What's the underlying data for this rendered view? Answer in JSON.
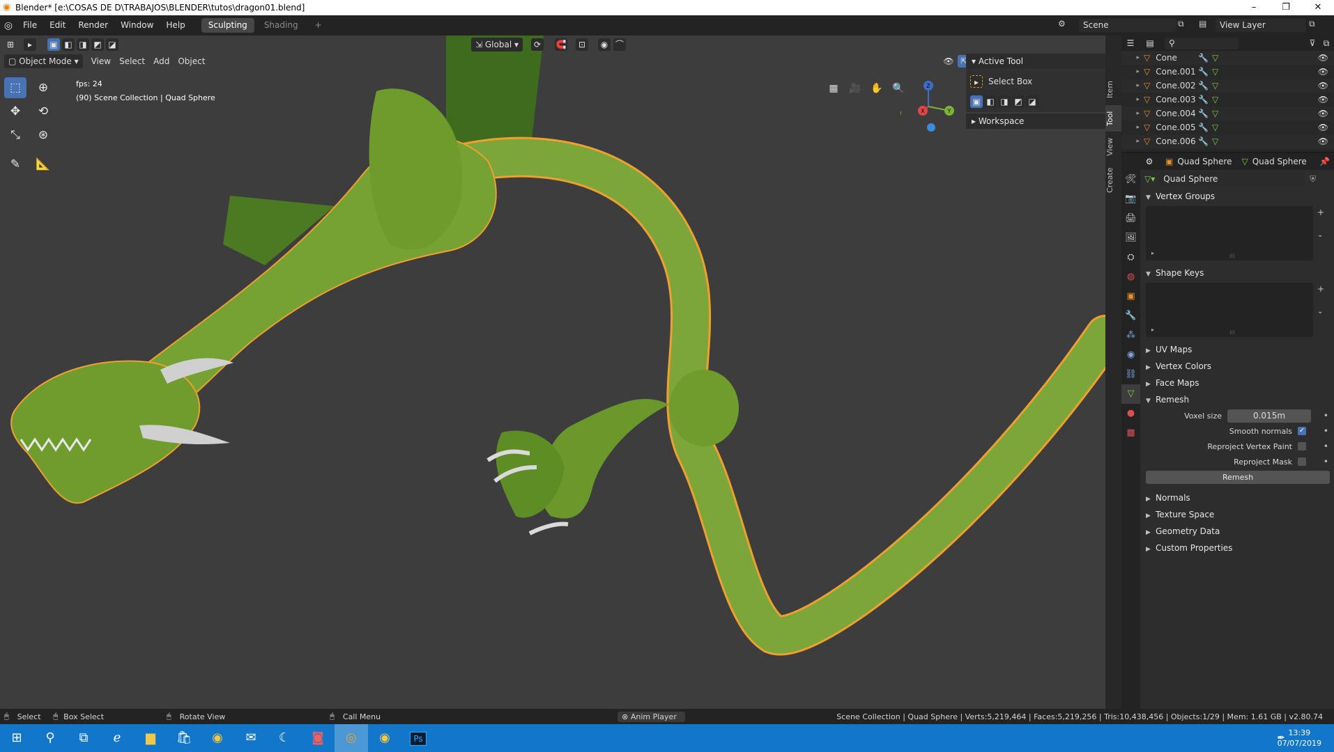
{
  "window": {
    "title": "Blender* [e:\\COSAS DE D\\TRABAJOS\\BLENDER\\tutos\\dragon01.blend]",
    "controls": [
      "–",
      "❐",
      "✕"
    ]
  },
  "menubar": {
    "items": [
      "File",
      "Edit",
      "Render",
      "Window",
      "Help"
    ],
    "workspaces": [
      "Sculpting",
      "Shading"
    ],
    "add_workspace": "+",
    "scene_label": "Scene",
    "view_layer_label": "View Layer"
  },
  "viewport": {
    "mode_select": "Object Mode",
    "menus": [
      "View",
      "Select",
      "Add",
      "Object"
    ],
    "transform_orientation": "Global",
    "fps_text": "fps: 24",
    "collection_text": "(90) Scene Collection | Quad Sphere",
    "gizmo_axes": {
      "x": "X",
      "y": "Y",
      "z": "Z"
    }
  },
  "npanel": {
    "active_tool_header": "Active Tool",
    "active_tool_name": "Select Box",
    "workspace_header": "Workspace",
    "tabs": [
      "Item",
      "Tool",
      "View",
      "Create"
    ]
  },
  "outliner": {
    "search_placeholder": "",
    "items": [
      "Cone",
      "Cone.001",
      "Cone.002",
      "Cone.003",
      "Cone.004",
      "Cone.005",
      "Cone.006"
    ]
  },
  "properties": {
    "object_name": "Quad Sphere",
    "data_name": "Quad Sphere",
    "mesh_name": "Quad Sphere",
    "panels": {
      "vertex_groups": "Vertex Groups",
      "shape_keys": "Shape Keys",
      "uv_maps": "UV Maps",
      "vertex_colors": "Vertex Colors",
      "face_maps": "Face Maps",
      "remesh": "Remesh",
      "normals": "Normals",
      "texture_space": "Texture Space",
      "geometry_data": "Geometry Data",
      "custom_properties": "Custom Properties"
    },
    "remesh": {
      "voxel_size_label": "Voxel size",
      "voxel_size_value": "0.015m",
      "smooth_normals_label": "Smooth normals",
      "smooth_normals_checked": true,
      "reproject_vertex_paint_label": "Reproject Vertex Paint",
      "reproject_mask_label": "Reproject Mask",
      "remesh_button": "Remesh"
    }
  },
  "statusbar": {
    "select": "Select",
    "box_select": "Box Select",
    "rotate_view": "Rotate View",
    "call_menu": "Call Menu",
    "anim_player": "Anim Player",
    "stats": "Scene Collection | Quad Sphere | Verts:5,219,464 | Faces:5,219,256 | Tris:10,438,456 | Objects:1/29 | Mem: 1.61 GB | v2.80.74"
  },
  "taskbar": {
    "time": "13:39",
    "date": "07/07/2019",
    "apps": [
      "start-icon",
      "search-icon",
      "task-view-icon",
      "edge-icon",
      "file-explorer-icon",
      "store-icon",
      "chrome-icon",
      "mail-icon",
      "app-icon",
      "discord-icon",
      "blender-icon",
      "chrome-icon-2",
      "photoshop-icon"
    ],
    "photoshop_label": "Ps"
  },
  "colors": {
    "selected_blue": "#4772b3",
    "outline_orange": "#f0a030",
    "dragon_green": "#7fa63a",
    "taskbar_blue": "#1276c9"
  }
}
